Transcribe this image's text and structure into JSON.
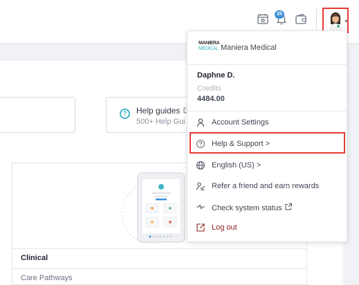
{
  "topbar": {
    "notification_count": "25",
    "icons": [
      "calendar-star-icon",
      "bell-icon",
      "wallet-icon"
    ]
  },
  "help_card": {
    "title": "Help guides",
    "subtitle": "500+ Help Gui"
  },
  "content": {
    "section_title": "Clinical",
    "first_item": "Care Pathways"
  },
  "dropdown": {
    "org_logo_line1": "MANIERA",
    "org_logo_line2": "MEDICAL",
    "org_name": "Maniera Medical",
    "user_name": "Daphne D.",
    "credits_label": "Credits",
    "credits_value": "4484.00",
    "items": [
      {
        "label": "Account Settings",
        "icon": "person-icon"
      },
      {
        "label": "Help & Support >",
        "icon": "help-circle-icon"
      },
      {
        "label": "English (US) >",
        "icon": "globe-icon"
      },
      {
        "label": "Refer a friend and earn rewards",
        "icon": "refer-icon"
      },
      {
        "label": "Check system status",
        "icon": "pulse-icon"
      },
      {
        "label": "Log out",
        "icon": "logout-icon"
      }
    ]
  },
  "colors": {
    "accent_teal": "#3fb6c6",
    "badge_blue": "#3b8fd6",
    "highlight_red": "#e53935",
    "logout_text": "#8a1f1f"
  }
}
